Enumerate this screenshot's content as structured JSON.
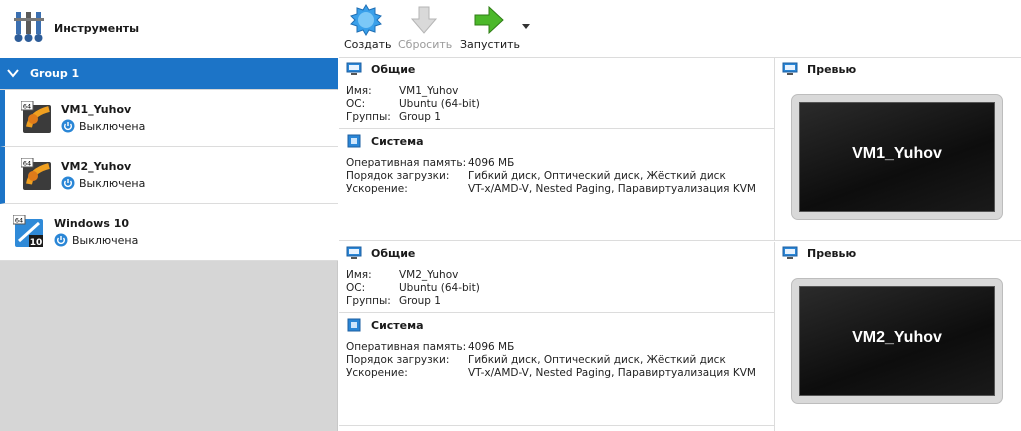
{
  "sidebar": {
    "tools_label": "Инструменты",
    "group_label": "Group 1",
    "vms": [
      {
        "name": "VM1_Yuhov",
        "state": "Выключена"
      },
      {
        "name": "VM2_Yuhov",
        "state": "Выключена"
      },
      {
        "name": "Windows 10",
        "state": "Выключена"
      }
    ],
    "os_badge": "64",
    "win_badge": "10"
  },
  "toolbar": {
    "create_label": "Создать",
    "reset_label": "Сбросить",
    "start_label": "Запустить"
  },
  "details": [
    {
      "general_title": "Общие",
      "name_key": "Имя:",
      "name_val": "VM1_Yuhov",
      "os_key": "ОС:",
      "os_val": "Ubuntu (64-bit)",
      "groups_key": "Группы:",
      "groups_val": "Group 1",
      "system_title": "Система",
      "ram_key": "Оперативная память:",
      "ram_val": "4096 МБ",
      "boot_key": "Порядок загрузки:",
      "boot_val": "Гибкий диск, Оптический диск, Жёсткий диск",
      "accel_key": "Ускорение:",
      "accel_val": "VT-x/AMD-V, Nested Paging, Паравиртуализация KVM",
      "preview_title": "Превью",
      "preview_name": "VM1_Yuhov"
    },
    {
      "general_title": "Общие",
      "name_key": "Имя:",
      "name_val": "VM2_Yuhov",
      "os_key": "ОС:",
      "os_val": "Ubuntu (64-bit)",
      "groups_key": "Группы:",
      "groups_val": "Group 1",
      "system_title": "Система",
      "ram_key": "Оперативная память:",
      "ram_val": "4096 МБ",
      "boot_key": "Порядок загрузки:",
      "boot_val": "Гибкий диск, Оптический диск, Жёсткий диск",
      "accel_key": "Ускорение:",
      "accel_val": "VT-x/AMD-V, Nested Paging, Паравиртуализация KVM",
      "preview_title": "Превью",
      "preview_name": "VM2_Yuhov"
    }
  ],
  "colors": {
    "selection_blue": "#1c74c7",
    "start_green": "#4cb82a",
    "create_blue": "#3aa0ea"
  },
  "icons": [
    "tools-icon",
    "chevron-down-icon",
    "ubuntu-vm-icon",
    "windows-vm-icon",
    "power-icon",
    "create-star-icon",
    "reset-arrow-icon",
    "start-arrow-icon",
    "dropdown-arrow-icon",
    "monitor-icon",
    "chip-icon"
  ]
}
